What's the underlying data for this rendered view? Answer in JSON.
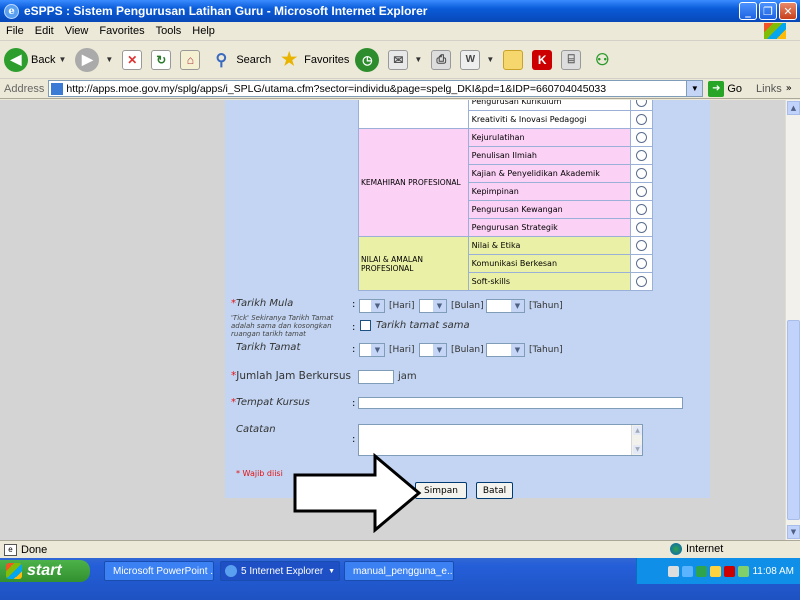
{
  "window": {
    "title": "eSPPS : Sistem Pengurusan Latihan Guru - Microsoft Internet Explorer",
    "minimize": "_",
    "maximize": "❐",
    "close": "✕"
  },
  "menu": [
    "File",
    "Edit",
    "View",
    "Favorites",
    "Tools",
    "Help"
  ],
  "toolbar": {
    "back": "Back",
    "search": "Search",
    "favorites": "Favorites"
  },
  "address": {
    "label": "Address",
    "url": "http://apps.moe.gov.my/splg/apps/i_SPLG/utama.cfm?sector=individu&page=spelg_DKI&pd=1&IDP=660704045033",
    "go": "Go",
    "links": "Links"
  },
  "skills_table": {
    "top_rows": [
      {
        "item": "Pengurusan Kurikulum"
      },
      {
        "item": "Kreativiti & Inovasi Pedagogi"
      }
    ],
    "groups": [
      {
        "category": "KEMAHIRAN PROFESIONAL",
        "color": "#fbd1f5",
        "items": [
          "Kejurulatihan",
          "Penulisan Ilmiah",
          "Kajian & Penyelidikan Akademik",
          "Kepimpinan",
          "Pengurusan Kewangan",
          "Pengurusan Strategik"
        ]
      },
      {
        "category": "NILAI & AMALAN PROFESIONAL",
        "color": "#eaf0a6",
        "items": [
          "Nilai & Etika",
          "Komunikasi Berkesan",
          "Soft-skills"
        ]
      }
    ]
  },
  "form": {
    "required_mark": "*",
    "start_date_label": "Tarikh Mula",
    "colon": ":",
    "day_unit": "[Hari]",
    "month_unit": "[Bulan]",
    "year_unit": "[Tahun]",
    "tick_note": "'Tick' Sekiranya Tarikh Tamat adalah sama dan kosongkan ruangan tarikh tamat",
    "same_end_date_label": "Tarikh tamat sama",
    "end_date_label": "Tarikh Tamat",
    "hours_label": "Jumlah Jam Berkursus",
    "hours_unit": "jam",
    "location_label": "Tempat Kursus",
    "notes_label": "Catatan",
    "required_note": "* Wajib diisi",
    "save_button": "Simpan",
    "cancel_button": "Batal"
  },
  "status": {
    "text": "Done",
    "zone": "Internet"
  },
  "taskbar": {
    "start": "start",
    "tasks": [
      "Microsoft PowerPoint ...",
      "5 Internet Explorer",
      "manual_pengguna_e..."
    ],
    "clock": "11:08 AM"
  }
}
